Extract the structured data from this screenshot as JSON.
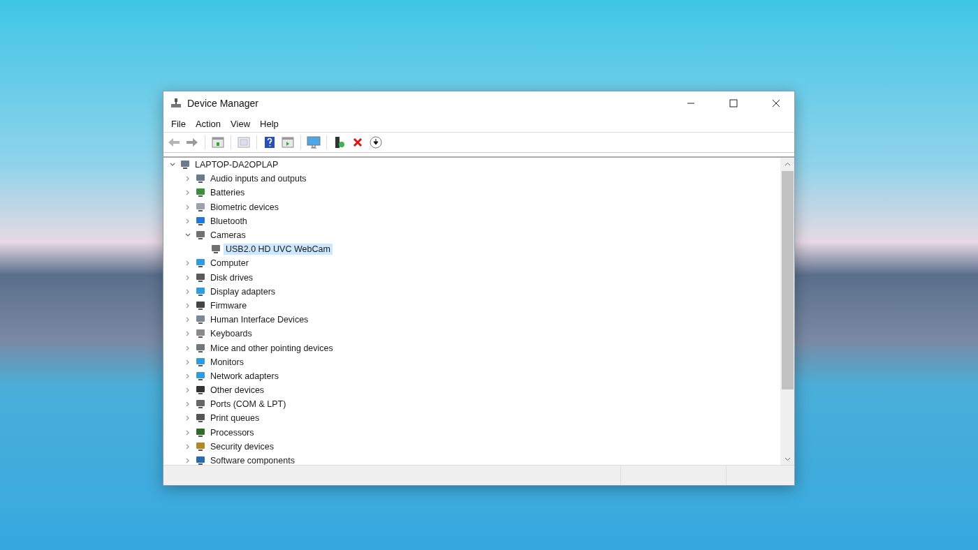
{
  "window": {
    "title": "Device Manager"
  },
  "menu": [
    "File",
    "Action",
    "View",
    "Help"
  ],
  "tree": {
    "label": "LAPTOP-DA2OPLAP",
    "expanded": true,
    "selected": false,
    "children": [
      {
        "label": "Audio inputs and outputs",
        "expanded": false,
        "selected": false
      },
      {
        "label": "Batteries",
        "expanded": false,
        "selected": false
      },
      {
        "label": "Biometric devices",
        "expanded": false,
        "selected": false
      },
      {
        "label": "Bluetooth",
        "expanded": false,
        "selected": false
      },
      {
        "label": "Cameras",
        "expanded": true,
        "selected": false,
        "children": [
          {
            "label": "USB2.0 HD UVC WebCam",
            "selected": true
          }
        ]
      },
      {
        "label": "Computer",
        "expanded": false,
        "selected": false
      },
      {
        "label": "Disk drives",
        "expanded": false,
        "selected": false
      },
      {
        "label": "Display adapters",
        "expanded": false,
        "selected": false
      },
      {
        "label": "Firmware",
        "expanded": false,
        "selected": false
      },
      {
        "label": "Human Interface Devices",
        "expanded": false,
        "selected": false
      },
      {
        "label": "Keyboards",
        "expanded": false,
        "selected": false
      },
      {
        "label": "Mice and other pointing devices",
        "expanded": false,
        "selected": false
      },
      {
        "label": "Monitors",
        "expanded": false,
        "selected": false
      },
      {
        "label": "Network adapters",
        "expanded": false,
        "selected": false
      },
      {
        "label": "Other devices",
        "expanded": false,
        "selected": false
      },
      {
        "label": "Ports (COM & LPT)",
        "expanded": false,
        "selected": false
      },
      {
        "label": "Print queues",
        "expanded": false,
        "selected": false
      },
      {
        "label": "Processors",
        "expanded": false,
        "selected": false
      },
      {
        "label": "Security devices",
        "expanded": false,
        "selected": false
      },
      {
        "label": "Software components",
        "expanded": false,
        "selected": false
      }
    ]
  }
}
